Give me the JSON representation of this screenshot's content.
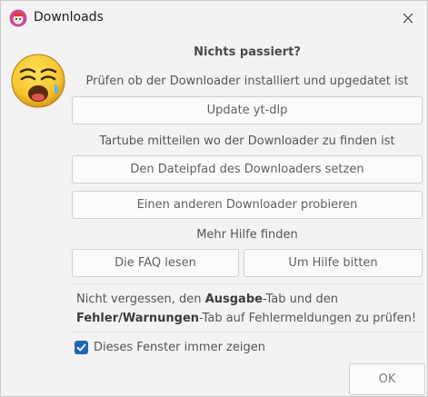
{
  "window": {
    "title": "Downloads"
  },
  "content": {
    "heading": "Nichts passiert?",
    "check_installed_label": "Prüfen ob der Downloader installiert und upgedatet ist",
    "update_button": "Update yt-dlp",
    "tell_path_label": "Tartube mitteilen wo der Downloader zu finden ist",
    "set_path_button": "Den Dateipfad des Downloaders setzen",
    "other_downloader_button": "Einen anderen Downloader probieren",
    "more_help_label": "Mehr Hilfe finden",
    "faq_button": "Die FAQ lesen",
    "help_button": "Um Hilfe bitten",
    "note": {
      "part1": "Nicht vergessen, den ",
      "bold1": "Ausgabe",
      "part2": "-Tab und den",
      "bold2": "Fehler/Warnungen",
      "part3": "-Tab auf Fehlermeldungen zu prüfen!"
    },
    "always_show_label": "Dieses Fenster immer zeigen",
    "always_show_checked": true,
    "ok_button": "OK"
  },
  "icons": {
    "app": "app-icon",
    "close": "close-icon",
    "emoji": "crying-face-emoji",
    "check": "checkmark-icon"
  },
  "colors": {
    "accent": "#1f66b5",
    "emoji_yellow": "#f7c631"
  }
}
